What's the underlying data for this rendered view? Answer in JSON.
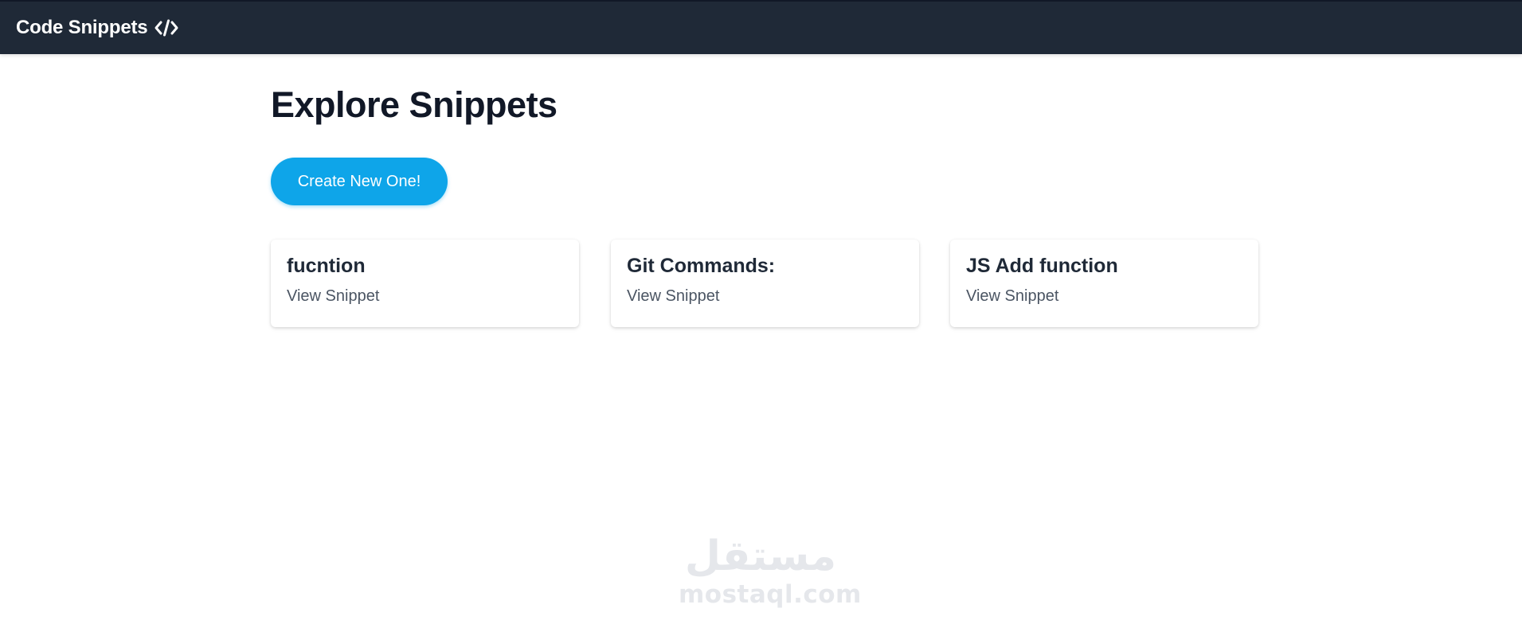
{
  "navbar": {
    "brand_label": "Code Snippets",
    "brand_icon": "code-icon",
    "background": "#1f2937"
  },
  "main": {
    "title": "Explore Snippets",
    "create_button_label": "Create New One!",
    "accent": "#0ea5e9"
  },
  "snippets": [
    {
      "title": "fucntion",
      "link_label": "View Snippet"
    },
    {
      "title": "Git Commands:",
      "link_label": "View Snippet"
    },
    {
      "title": "JS Add function",
      "link_label": "View Snippet"
    }
  ],
  "watermark": {
    "arabic": "مستقل",
    "latin": "mostaql.com"
  }
}
